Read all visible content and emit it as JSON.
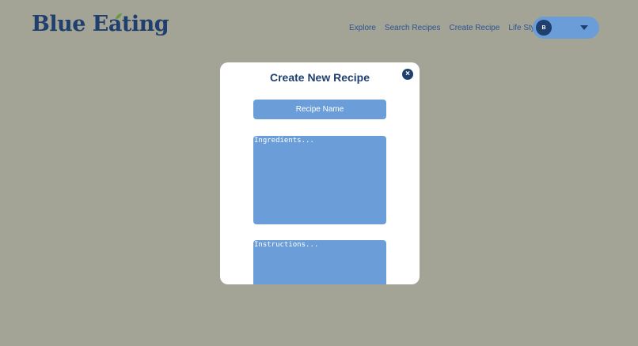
{
  "header": {
    "logo_text": "Blue Eating",
    "nav": [
      "Explore",
      "Search Recipes",
      "Create Recipe",
      "Life Style"
    ],
    "profile": {
      "avatar_initial": "B"
    }
  },
  "modal": {
    "title": "Create New Recipe",
    "close_label": "×",
    "recipe_name_placeholder": "Recipe Name",
    "ingredients_placeholder": "Ingredients...",
    "instructions_placeholder": "Instructions..."
  },
  "colors": {
    "background": "#a3a396",
    "brand_dark": "#1f3f6e",
    "accent": "#6b9ed8",
    "leaf": "#6a9a3c"
  },
  "icons": [
    "leaf-icon",
    "close-icon",
    "chevron-down-icon"
  ]
}
